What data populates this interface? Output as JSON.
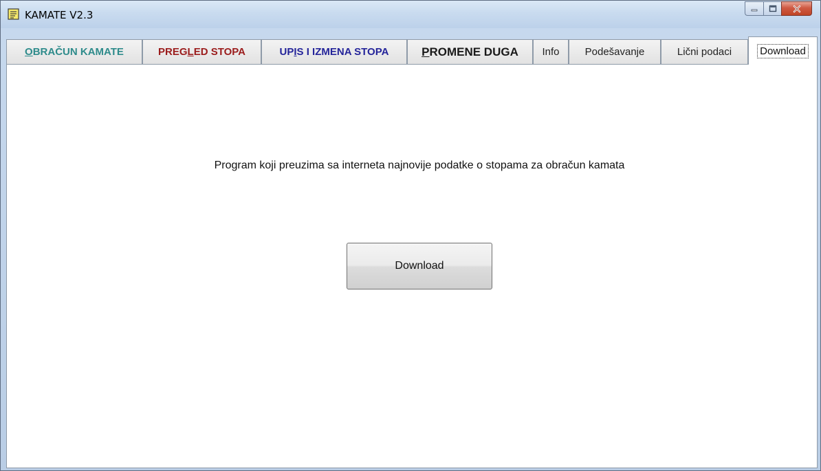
{
  "window": {
    "title": "KAMATE V2.3",
    "app_icon": "notepad-icon",
    "controls": [
      "minimize-icon",
      "maximize-icon",
      "close-icon"
    ]
  },
  "tabs": [
    {
      "label": "OBRAČUN KAMATE",
      "color": "#2e8b8b",
      "underline_char": "O"
    },
    {
      "label": "PREGLED STOPA",
      "color": "#9b1c1c",
      "underline_char": "L"
    },
    {
      "label": "UPIS I IZMENA STOPA",
      "color": "#24249a",
      "underline_char": "I"
    },
    {
      "label": "PROMENE DUGA",
      "color": "#1a1a1a",
      "underline_char": "P"
    },
    {
      "label": "Info"
    },
    {
      "label": "Podešavanje"
    },
    {
      "label": "Lični podaci"
    },
    {
      "label": "Download",
      "active": true
    }
  ],
  "main": {
    "description": "Program koji preuzima sa interneta najnovije podatke o stopama za obračun kamata",
    "download_button": "Download"
  }
}
